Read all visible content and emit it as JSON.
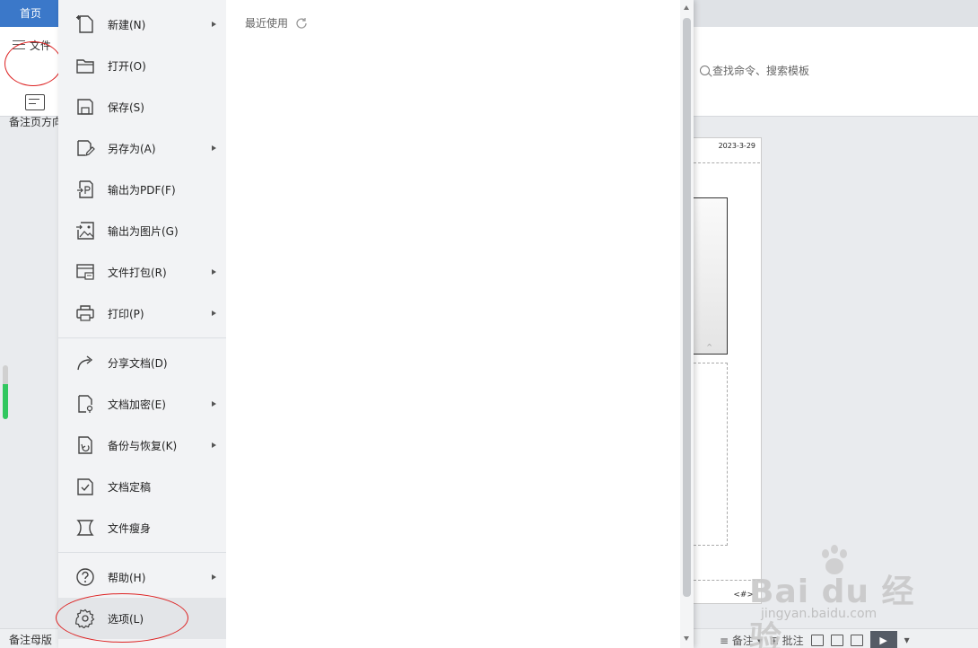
{
  "tabs": {
    "home": "首页"
  },
  "ribbon": {
    "file_label": "文件",
    "notes_direction_label": "备注页方向",
    "search_placeholder": "查找命令、搜索模板"
  },
  "slide": {
    "date": "2023-3-29"
  },
  "file_menu": {
    "items": [
      {
        "label": "新建(N)",
        "icon": "new-file-icon",
        "has_submenu": true
      },
      {
        "label": "打开(O)",
        "icon": "open-folder-icon",
        "has_submenu": false
      },
      {
        "label": "保存(S)",
        "icon": "save-icon",
        "has_submenu": false
      },
      {
        "label": "另存为(A)",
        "icon": "save-as-icon",
        "has_submenu": true
      },
      {
        "label": "输出为PDF(F)",
        "icon": "pdf-icon",
        "has_submenu": false
      },
      {
        "label": "输出为图片(G)",
        "icon": "image-icon",
        "has_submenu": false
      },
      {
        "label": "文件打包(R)",
        "icon": "package-icon",
        "has_submenu": true
      },
      {
        "label": "打印(P)",
        "icon": "print-icon",
        "has_submenu": true
      },
      {
        "label": "分享文档(D)",
        "icon": "share-icon",
        "has_submenu": false
      },
      {
        "label": "文档加密(E)",
        "icon": "encrypt-icon",
        "has_submenu": true
      },
      {
        "label": "备份与恢复(K)",
        "icon": "backup-icon",
        "has_submenu": true
      },
      {
        "label": "文档定稿",
        "icon": "finalize-icon",
        "has_submenu": false
      },
      {
        "label": "文件瘦身",
        "icon": "slim-icon",
        "has_submenu": false
      },
      {
        "label": "帮助(H)",
        "icon": "help-icon",
        "has_submenu": true
      },
      {
        "label": "选项(L)",
        "icon": "gear-icon",
        "has_submenu": false
      }
    ],
    "recent_title": "最近使用"
  },
  "statusbar": {
    "left_label": "备注母版",
    "notes_label": "备注",
    "comment_label": "批注"
  },
  "watermark": {
    "brand": "Bai du 经验",
    "url": "jingyan.baidu.com"
  },
  "colors": {
    "accent": "#3b78c9",
    "annotation_red": "#dd2222"
  }
}
